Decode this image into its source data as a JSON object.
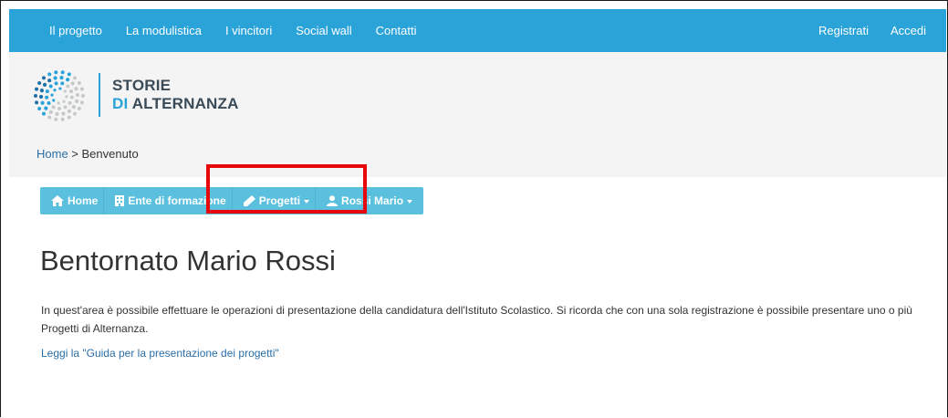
{
  "topbar": {
    "left_links": [
      "Il progetto",
      "La modulistica",
      "I vincitori",
      "Social wall",
      "Contatti"
    ],
    "right_links": [
      "Registrati",
      "Accedi"
    ]
  },
  "logo": {
    "line1": "STORIE",
    "line2_prefix": "DI",
    "line2_rest": " ALTERNANZA"
  },
  "breadcrumb": {
    "home": "Home",
    "separator": " > ",
    "current": "Benvenuto"
  },
  "subnav": {
    "items": [
      {
        "label": "Home",
        "icon": "home-icon"
      },
      {
        "label": "Ente di formazione",
        "icon": "building-icon"
      },
      {
        "label": "Progetti",
        "icon": "pencil-icon",
        "dropdown": true
      },
      {
        "label": "Rossi Mario",
        "icon": "user-icon",
        "dropdown": true
      }
    ]
  },
  "main": {
    "title": "Bentornato Mario Rossi",
    "intro": "In quest'area è possibile effettuare le operazioni di presentazione della candidatura dell'Istituto Scolastico. Si ricorda che con una sola registrazione è possibile presentare uno o più Progetti di Alternanza.",
    "guide_link": "Leggi la \"Guida per la presentazione dei progetti\""
  },
  "colors": {
    "topbar": "#2aa3d9",
    "subnav": "#5bc0de",
    "highlight": "#e8070b",
    "link": "#2a6ea6"
  }
}
